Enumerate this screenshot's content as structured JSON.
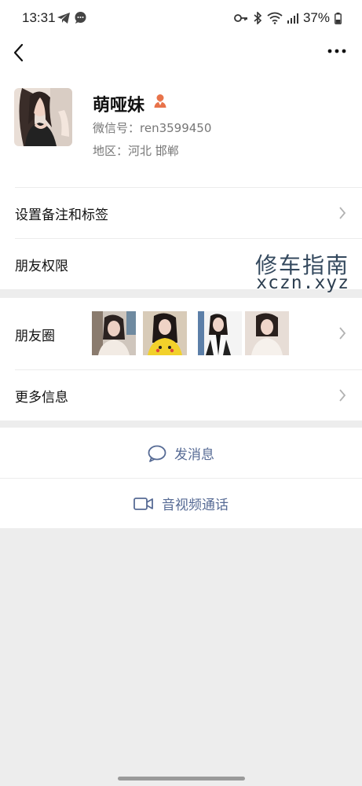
{
  "status_bar": {
    "time": "13:31",
    "battery": "37%",
    "icons": [
      "telegram-icon",
      "chat-bubble-icon",
      "key-icon",
      "bluetooth-icon",
      "wifi-icon",
      "signal-icon",
      "battery-icon"
    ]
  },
  "nav": {
    "back_icon": "chevron-left-icon",
    "more_icon": "more-horizontal-icon"
  },
  "profile": {
    "name": "萌哑妹",
    "wechat_id": "微信号：ren3599450",
    "region": "地区：河北  邯郸",
    "gender_icon": "female-icon"
  },
  "menu": {
    "remark_tags": "设置备注和标签",
    "permissions": "朋友权限",
    "moments": "朋友圈",
    "more_info": "更多信息"
  },
  "watermark": {
    "line1": "修车指南",
    "line2": "xczn.xyz"
  },
  "actions": {
    "send_message": "发消息",
    "video_call": "音视频通话"
  },
  "colors": {
    "link_blue": "#576b95",
    "page_bg": "#ededed",
    "gender_orange": "#e8734a"
  }
}
